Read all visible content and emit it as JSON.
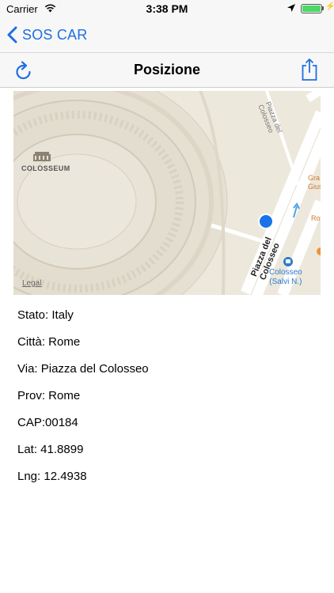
{
  "status_bar": {
    "carrier": "Carrier",
    "time": "3:38 PM",
    "battery_level_percent": 100,
    "icons": [
      "wifi-icon",
      "location-arrow-icon",
      "battery-icon",
      "charging-bolt-icon"
    ]
  },
  "nav": {
    "back_label": "SOS CAR"
  },
  "toolbar": {
    "title": "Posizione",
    "left_icon": "refresh-icon",
    "right_icon": "share-icon"
  },
  "map": {
    "landmark_label": "COLOSSEUM",
    "street_main": "Piazza del Colosseo",
    "street_top": "Piazza del Colosseo",
    "poi_right_1_line1": "Gra",
    "poi_right_1_line2": "Gius",
    "poi_right_2": "Roy",
    "bus_stop_line1": "Colosseo",
    "bus_stop_line2": "(Salvi N.)",
    "legal": "Legal",
    "colors": {
      "background": "#ede8dc",
      "road": "#ffffff",
      "pin": "#1a73e8",
      "poi": "#d17a2a",
      "transit": "#2b7bd0"
    }
  },
  "details": {
    "stato": "Stato: Italy",
    "citta": "Città: Rome",
    "via": "Via: Piazza del Colosseo",
    "prov": "Prov: Rome",
    "cap": "CAP:00184",
    "lat": "Lat: 41.8899",
    "lng": "Lng: 12.4938"
  },
  "accent_color": "#1e6fe0"
}
